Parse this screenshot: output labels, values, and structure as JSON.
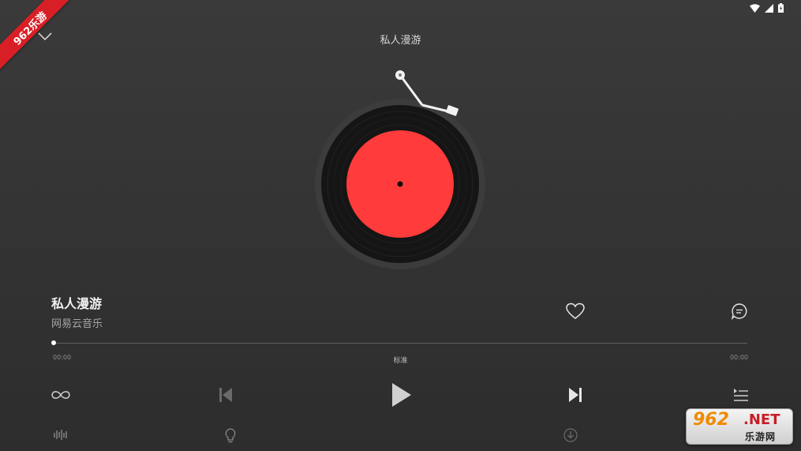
{
  "ribbon": {
    "text": "962乐游"
  },
  "header": {
    "title": "私人漫游"
  },
  "song": {
    "title": "私人漫游",
    "artist": "网易云音乐"
  },
  "progress": {
    "current": "00:00",
    "total": "00:00",
    "quality": "标准",
    "fraction": 0
  },
  "colors": {
    "background": "#353535",
    "label": "#ff3b3b",
    "vinyl": "#151515",
    "accent": "#ffffff"
  },
  "icons": {
    "collapse": "chevron-down-icon",
    "like": "heart-icon",
    "comment": "comment-icon",
    "loop": "infinity-loop-icon",
    "prev": "skip-previous-icon",
    "play": "play-icon",
    "next": "skip-next-icon",
    "playlist": "playlist-icon",
    "effect": "sound-effect-icon",
    "tips": "lightbulb-icon",
    "download": "download-icon"
  },
  "watermark": {
    "big": "962",
    "net": ".NET",
    "sub": "乐游网"
  }
}
